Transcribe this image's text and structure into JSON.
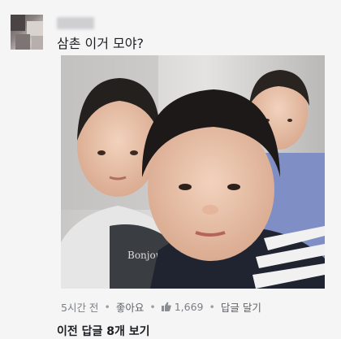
{
  "comment": {
    "text": "삼촌 이거 모야?"
  },
  "meta": {
    "time": "5시간 전",
    "like_label": "좋아요",
    "like_count": "1,669",
    "reply_label": "답글 달기",
    "separator": "•"
  },
  "replies": {
    "more_label": "이전 답글 8개 보기"
  },
  "photo": {
    "shirt_print": "Bonjour mom"
  },
  "colors": {
    "background": "#f5f5f6",
    "meta_text": "#7c7f84",
    "text": "#1c1e21"
  },
  "icons": {
    "like": "thumbs-up-icon"
  }
}
